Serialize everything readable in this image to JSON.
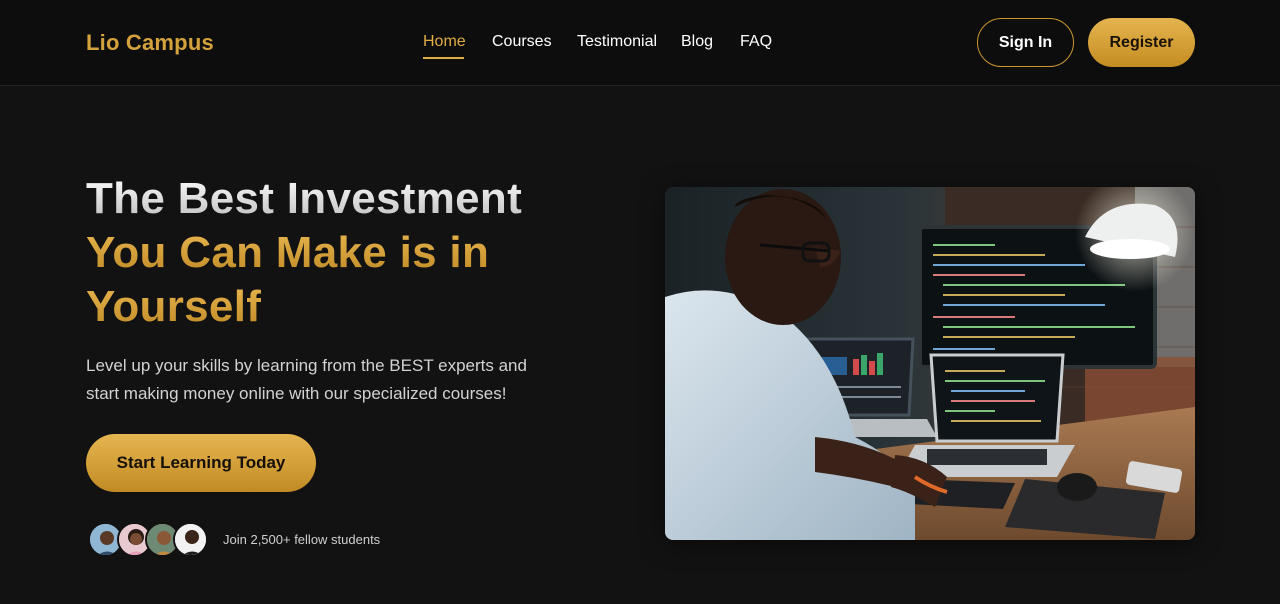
{
  "header": {
    "logo": "Lio Campus",
    "nav": [
      {
        "label": "Home",
        "active": true
      },
      {
        "label": "Courses"
      },
      {
        "label": "Testimonial"
      },
      {
        "label": "Blog"
      },
      {
        "label": "FAQ"
      }
    ],
    "signin_label": "Sign In",
    "register_label": "Register"
  },
  "hero": {
    "title_line1": "The Best Investment",
    "title_line2": "You Can Make is in",
    "title_line3": "Yourself",
    "subtitle": "Level up your skills by learning from the BEST experts and start making money online with our specialized courses!",
    "cta_label": "Start Learning Today",
    "join_text": "Join 2,500+ fellow students",
    "avatar_count": 4,
    "image": "photo-person-coding-at-desk"
  },
  "colors": {
    "accent": "#e0ad45",
    "background": "#121212",
    "header_bg": "#0d0d0d"
  }
}
